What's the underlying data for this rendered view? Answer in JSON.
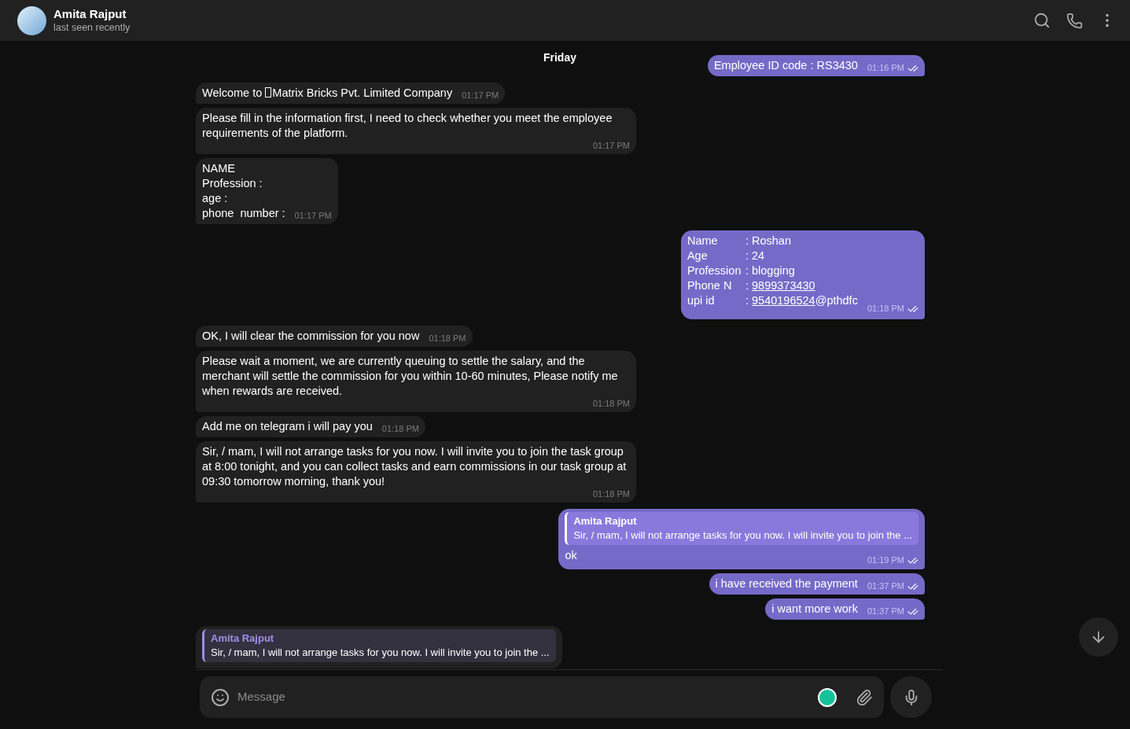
{
  "header": {
    "name": "Amita Rajput",
    "status": "last seen recently"
  },
  "date_label": "Friday",
  "messages": [
    {
      "kind": "text",
      "out": true,
      "read": true,
      "text": "Employee ID code : RS3430",
      "time": "01:16 PM"
    },
    {
      "kind": "text",
      "out": false,
      "text": "Welcome to ",
      "missing_glyph": true,
      "text_after": "Matrix Bricks Pvt. Limited Company",
      "time": "01:17 PM"
    },
    {
      "kind": "text",
      "out": false,
      "text": "Please fill in the information first, I need to check whether you meet the employee requirements of the platform.",
      "time": "01:17 PM"
    },
    {
      "kind": "text",
      "out": false,
      "text": "NAME\nProfession :\nage :\nphone  number :",
      "time": "01:17 PM"
    },
    {
      "kind": "fields",
      "out": true,
      "read": true,
      "time": "01:18 PM",
      "fields": [
        {
          "label": "Name",
          "value": ": Roshan"
        },
        {
          "label": "Age",
          "value": ": 24"
        },
        {
          "label": "Profession",
          "value": ": blogging"
        },
        {
          "label": "Phone N",
          "value": ":",
          "link": "9899373430"
        },
        {
          "label": "upi id",
          "value": ":",
          "link": "9540196524",
          "suffix": "@pthdfc"
        }
      ]
    },
    {
      "kind": "text",
      "out": false,
      "text": "OK, I will clear the commission for you now",
      "time": "01:18 PM"
    },
    {
      "kind": "text",
      "out": false,
      "text": "Please wait a moment, we are currently queuing to settle the salary, and the merchant will settle the commission for you within 10-60 minutes, Please notify me when rewards are received.",
      "time": "01:18 PM"
    },
    {
      "kind": "text",
      "out": false,
      "text": "Add me on telegram i will pay you",
      "time": "01:18 PM"
    },
    {
      "kind": "text",
      "out": false,
      "text": "Sir, / mam, I will not arrange tasks for you now. I will invite you to join the task group at 8:00 tonight, and you can collect tasks and earn commissions in our task group at 09:30 tomorrow morning, thank you!",
      "time": "01:18 PM"
    },
    {
      "kind": "reply",
      "out": true,
      "read": true,
      "reply_author": "Amita Rajput",
      "reply_text": "Sir, / mam, I will not arrange tasks for you now. I will invite you to join the ...",
      "text": "ok",
      "time": "01:19 PM"
    },
    {
      "kind": "text",
      "out": true,
      "read": true,
      "text": "i have received the payment",
      "time": "01:37 PM"
    },
    {
      "kind": "text",
      "out": true,
      "read": true,
      "text": "i want more work",
      "time": "01:37 PM"
    },
    {
      "kind": "reply",
      "out": false,
      "reply_author": "Amita Rajput",
      "reply_text": "Sir, / mam, I will not arrange tasks for you now. I will invite you to join the ..."
    }
  ],
  "composer": {
    "placeholder": "Message"
  }
}
